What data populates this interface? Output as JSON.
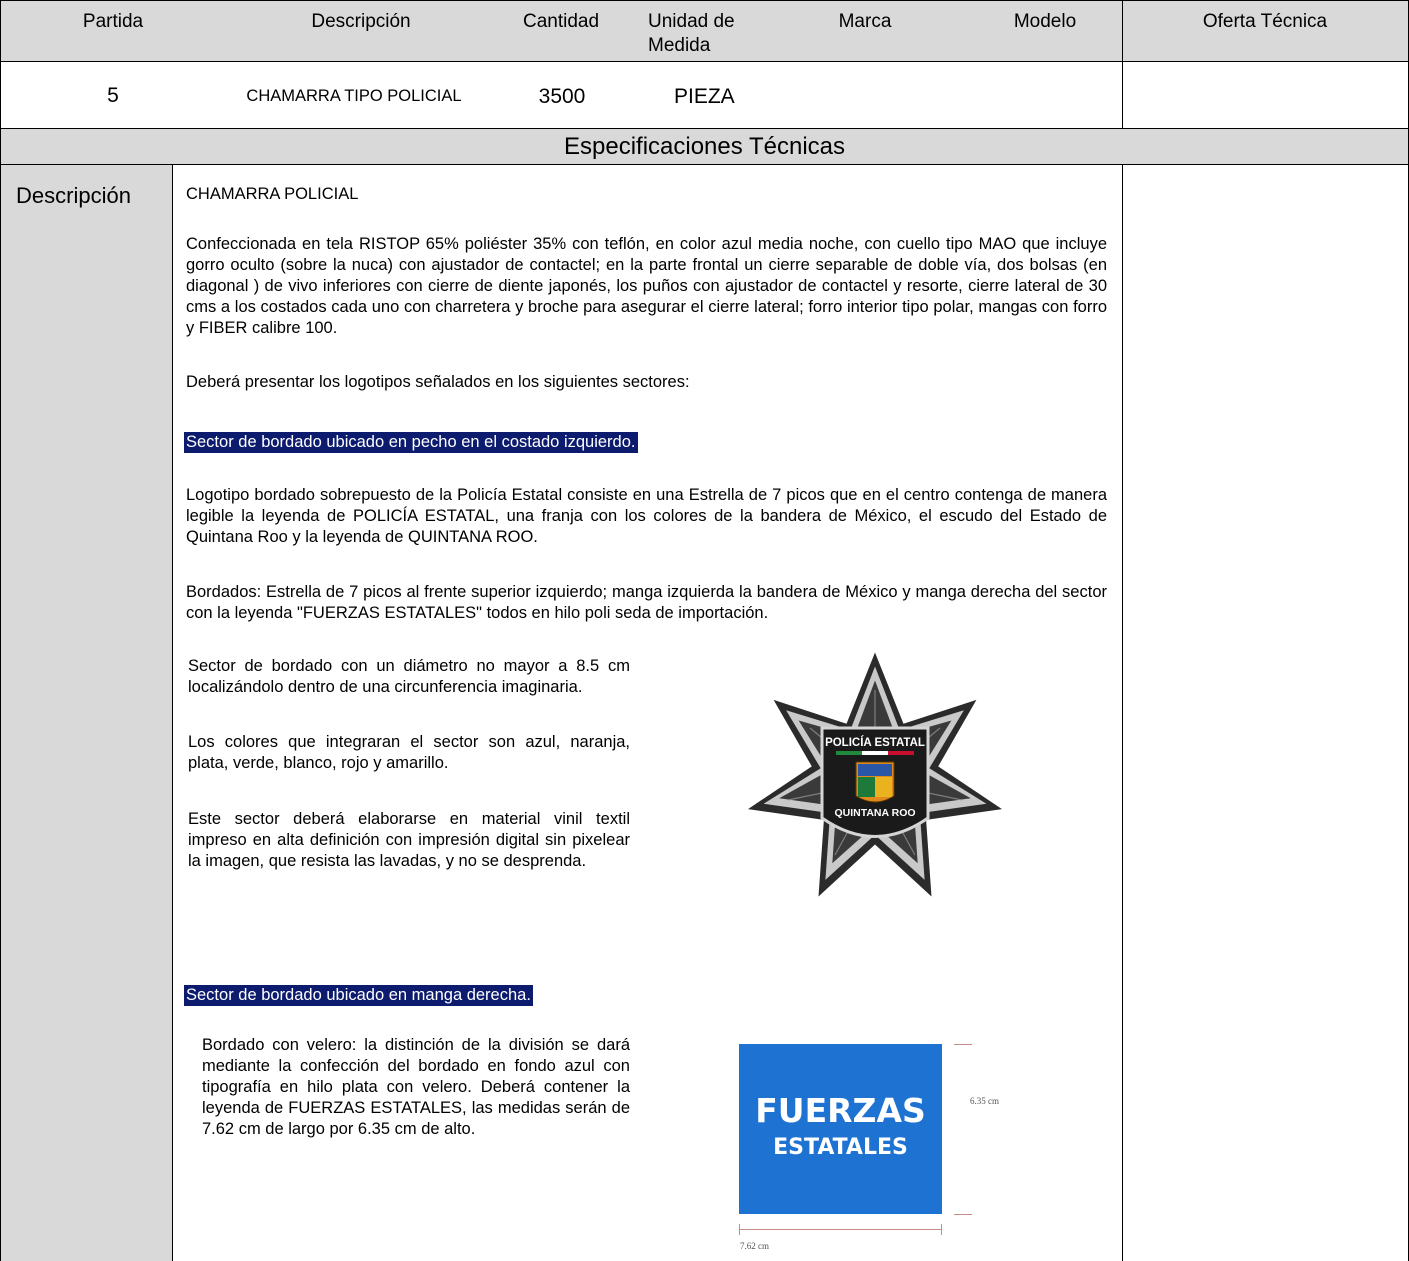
{
  "header": {
    "partida": "Partida",
    "descripcion": "Descripción",
    "cantidad": "Cantidad",
    "unidad_line1": "Unidad de",
    "unidad_line2": "Medida",
    "marca": "Marca",
    "modelo": "Modelo",
    "oferta": "Oferta Técnica"
  },
  "item": {
    "partida": "5",
    "descripcion": "CHAMARRA TIPO POLICIAL",
    "cantidad": "3500",
    "unidad": "PIEZA"
  },
  "spec_title": "Especificaciones Técnicas",
  "spec_label": "Descripción",
  "spec": {
    "title": "CHAMARRA POLICIAL",
    "p1": "Confeccionada en tela RISTOP 65% poliéster 35% con teflón, en color azul media noche, con cuello tipo MAO que incluye gorro oculto (sobre la nuca) con ajustador de contactel; en la parte frontal un cierre separable de doble vía, dos bolsas (en diagonal ) de vivo inferiores con cierre de diente japonés, los puños con ajustador de contactel y resorte, cierre lateral de 30 cms a los costados cada uno con charretera y broche para asegurar el cierre lateral; forro interior tipo polar, mangas con forro y FIBER calibre 100.",
    "p2": "Deberá presentar los logotipos señalados en los siguientes sectores:",
    "sector1": "Sector de bordado ubicado en pecho en el costado izquierdo.",
    "p3": "Logotipo bordado sobrepuesto de la Policía Estatal consiste en una Estrella de 7 picos que en el centro contenga de manera legible la leyenda de POLICÍA ESTATAL, una franja con los colores de la bandera de México, el escudo del Estado de Quintana Roo y la leyenda de QUINTANA ROO.",
    "p4": "Bordados: Estrella de 7 picos al frente superior izquierdo; manga izquierda la bandera de México y manga derecha del sector con la leyenda \"FUERZAS ESTATALES\" todos en hilo poli seda de importación.",
    "s1_a": "Sector de bordado con un diámetro no mayor a 8.5 cm localizándolo dentro de una circunferencia imaginaria.",
    "s1_b": "Los colores que integraran el sector son azul, naranja, plata, verde, blanco, rojo y amarillo.",
    "s1_c": "Este sector deberá elaborarse en material vinil textil impreso en alta definición con impresión digital sin pixelear la imagen, que resista las lavadas, y no se desprenda.",
    "sector2": "Sector de bordado ubicado en manga derecha.",
    "s2_a": "Bordado con velero: la distinción de la división se dará mediante la confección del bordado en fondo azul con tipografía en hilo plata con velero. Deberá contener la leyenda de FUERZAS ESTATALES, las medidas serán de 7.62 cm de largo por 6.35 cm de alto."
  },
  "badge": {
    "top_text": "POLICÍA ESTATAL",
    "bottom_text": "QUINTANA ROO"
  },
  "patch": {
    "line1": "FUERZAS",
    "line2": "ESTATALES",
    "dim_height": "6.35 cm",
    "dim_width": "7.62 cm",
    "color": "#1e73d2"
  }
}
